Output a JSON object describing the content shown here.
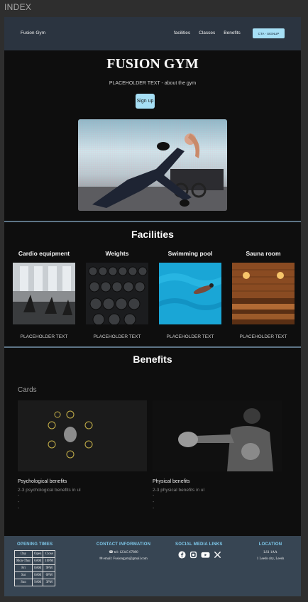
{
  "frame": {
    "label": "INDEX"
  },
  "nav": {
    "brand": "Fusion Gym",
    "links": [
      "facilities",
      "Classes",
      "Benefits"
    ],
    "cta": "CTA - SIGNUP"
  },
  "hero": {
    "title": "FUSION GYM",
    "subtitle": "PLACEHOLDER TEXT - about the gym",
    "button": "Sign up"
  },
  "facilities": {
    "title": "Facilities",
    "items": [
      {
        "name": "Cardio equipment",
        "desc": "PLACEHOLDER TEXT"
      },
      {
        "name": "Weights",
        "desc": "PLACEHOLDER TEXT"
      },
      {
        "name": "Swimming pool",
        "desc": "PLACEHOLDER TEXT"
      },
      {
        "name": "Sauna room",
        "desc": "PLACEHOLDER TEXT"
      }
    ]
  },
  "benefits": {
    "title": "Benefits",
    "cards_label": "Cards",
    "cards": [
      {
        "title": "Psychological benefits",
        "desc": "2-3 psychological benefits in ul",
        "bullets": [
          "-",
          "-",
          "-"
        ]
      },
      {
        "title": "Physical benefits",
        "desc": "2-3 physical benefits in ul",
        "bullets": [
          "-",
          "-",
          "-"
        ]
      }
    ]
  },
  "footer": {
    "opening": {
      "title": "OPENING TIMES",
      "header": [
        "Day",
        "Open",
        "Close"
      ],
      "rows": [
        [
          "Mon-Thur",
          "6AM",
          "10PM"
        ],
        [
          "Fri",
          "8AM",
          "9PM"
        ],
        [
          "Sat",
          "8AM",
          "6PM"
        ],
        [
          "Sun",
          "9AM",
          "3PM"
        ]
      ]
    },
    "contact": {
      "title": "CONTACT INFORMATION",
      "phone": "tel: 12345 67890",
      "email": "email: Fusiongym@gmail.com"
    },
    "social": {
      "title": "SOCIAL MEDIA LINKS",
      "icons": [
        "facebook-icon",
        "instagram-icon",
        "youtube-icon",
        "x-icon"
      ]
    },
    "location": {
      "title": "LOCATION",
      "line1": "LS1 1AA",
      "line2": "1 Leeds city, Leeds"
    }
  },
  "colors": {
    "accent": "#a6dff5",
    "nav_bg": "#2b3440",
    "footer_bg": "#374553",
    "footer_heading": "#7ec8ea",
    "divider": "#5d7486"
  }
}
